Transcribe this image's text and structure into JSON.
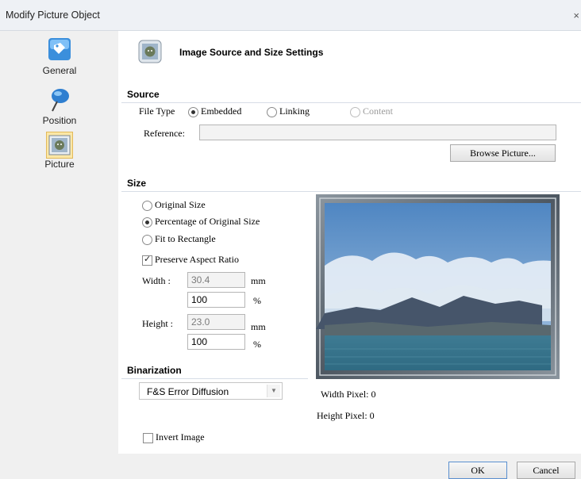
{
  "window": {
    "title": "Modify Picture Object",
    "close": "×"
  },
  "sidebar": {
    "items": [
      {
        "label": "General",
        "icon": "general-tag-icon"
      },
      {
        "label": "Position",
        "icon": "pushpin-icon"
      },
      {
        "label": "Picture",
        "icon": "picture-icon",
        "selected": true
      }
    ]
  },
  "header": {
    "title": "Image Source and Size Settings"
  },
  "source": {
    "heading": "Source",
    "file_type_label": "File Type",
    "options": [
      "Embedded",
      "Linking",
      "Content"
    ],
    "selected": "Embedded",
    "reference_label": "Reference:",
    "reference_value": "",
    "browse_button": "Browse Picture..."
  },
  "size": {
    "heading": "Size",
    "options": [
      "Original Size",
      "Percentage of Original Size",
      "Fit to Rectangle"
    ],
    "selected": "Percentage of Original Size",
    "preserve_aspect": {
      "label": "Preserve Aspect Ratio",
      "checked": true
    },
    "width_label": "Width :",
    "width_mm": "30.4",
    "width_pct": "100",
    "height_label": "Height :",
    "height_mm": "23.0",
    "height_pct": "100",
    "unit_mm": "mm",
    "unit_pct": "%"
  },
  "binarization": {
    "heading": "Binarization",
    "selected": "F&S Error Diffusion",
    "invert": {
      "label": "Invert Image",
      "checked": false
    }
  },
  "preview": {
    "width_pixel": "Width Pixel: 0",
    "height_pixel": "Height Pixel: 0"
  },
  "footer": {
    "ok": "OK",
    "cancel": "Cancel"
  },
  "colors": {
    "accent_selected": "#fbe7a6",
    "frame": "#5f6a74",
    "sky": "#6f9cc9"
  }
}
